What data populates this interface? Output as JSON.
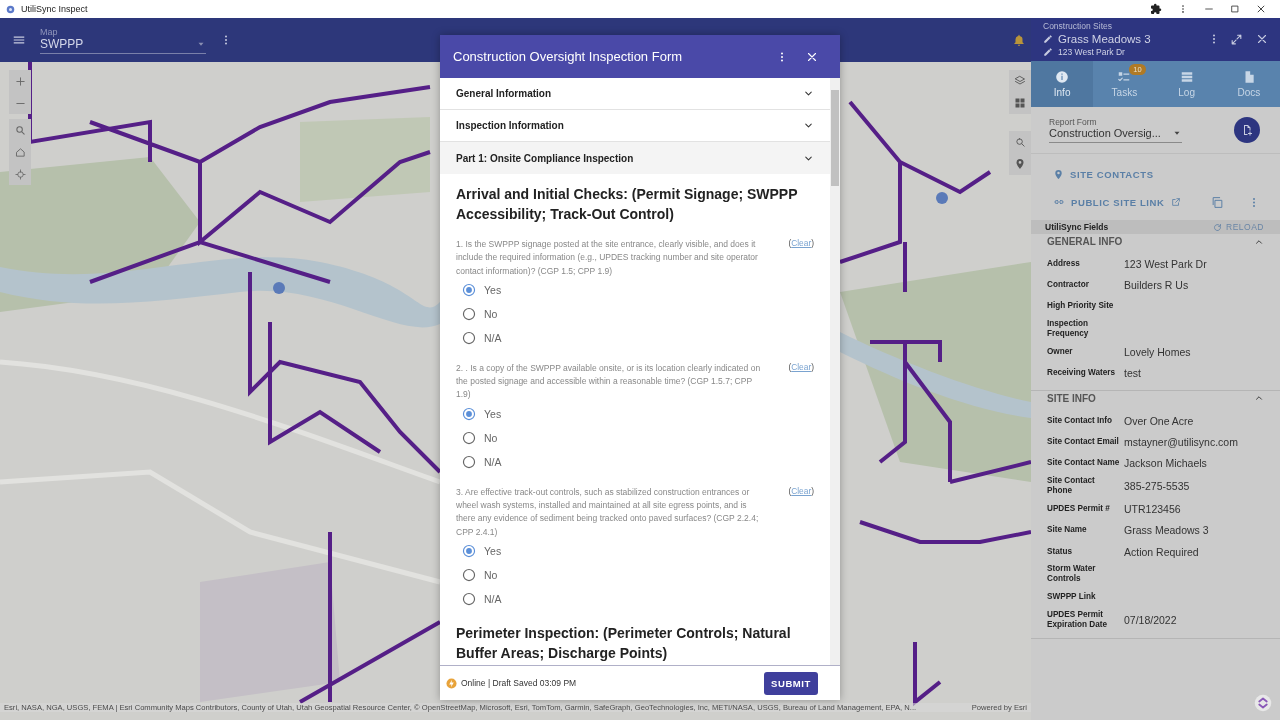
{
  "window": {
    "title": "UtiliSync Inspect"
  },
  "app_bar": {
    "label": "Map",
    "map_select": "SWPPP"
  },
  "map": {
    "kind": "picture",
    "attribution": "Esri, NASA, NGA, USGS, FEMA | Esri Community Maps Contributors, County of Utah, Utah Geospatial Resource Center, © OpenStreetMap, Microsoft, Esri, TomTom, Garmin, SafeGraph, GeoTechnologies, Inc, METI/NASA, USGS, Bureau of Land Management, EPA, N...",
    "powered_by": "Powered by Esri"
  },
  "site_panel": {
    "breadcrumb": "Construction Sites",
    "name": "Grass Meadows 3",
    "address": "123 West Park Dr",
    "tabs": [
      {
        "label": "Info",
        "selected": true
      },
      {
        "label": "Tasks",
        "selected": false,
        "badge": "10"
      },
      {
        "label": "Log",
        "selected": false
      },
      {
        "label": "Docs",
        "selected": false
      }
    ],
    "report_form": {
      "label": "Report Form",
      "value": "Construction Oversig..."
    },
    "site_contacts": "SITE CONTACTS",
    "public_site_link": "PUBLIC SITE LINK",
    "fields_header": "UtiliSync Fields",
    "reload": "RELOAD",
    "sections": [
      {
        "title": "GENERAL INFO",
        "expanded": true,
        "fields": [
          {
            "label": "Address",
            "value": "123 West Park Dr"
          },
          {
            "label": "Contractor",
            "value": "Builders R Us"
          },
          {
            "label": "High Priority Site"
          },
          {
            "label": "Inspection Frequency"
          },
          {
            "label": "Owner",
            "value": "Lovely Homes"
          },
          {
            "label": "Receiving Waters",
            "value": "test"
          }
        ]
      },
      {
        "title": "SITE INFO",
        "expanded": true,
        "fields": [
          {
            "label": "Site Contact Info",
            "value": "Over One Acre"
          },
          {
            "label": "Site Contact Email",
            "value": "mstayner@utilisync.com"
          },
          {
            "label": "Site Contact Name",
            "value": "Jackson Michaels"
          },
          {
            "label": "Site Contact Phone",
            "value": "385-275-5535"
          },
          {
            "label": "UPDES Permit #",
            "value": "UTR123456"
          },
          {
            "label": "Site Name",
            "value": "Grass Meadows 3"
          },
          {
            "label": "Status",
            "value": "Action Required"
          },
          {
            "label": "Storm Water Controls"
          },
          {
            "label": "SWPPP Link"
          },
          {
            "label": "UPDES Permit Expiration Date",
            "value": "07/18/2022"
          }
        ]
      }
    ]
  },
  "form": {
    "title": "Construction Oversight Inspection Form",
    "sections": [
      {
        "title": "General Information",
        "highlighted": false
      },
      {
        "title": "Inspection Information",
        "highlighted": false
      },
      {
        "title": "Part 1: Onsite Compliance Inspection",
        "highlighted": true
      }
    ],
    "groups": [
      {
        "heading": "Arrival and Initial Checks: (Permit Signage; SWPPP Accessibility; Track-Out Control)",
        "questions": [
          {
            "text": "1. Is the SWPPP signage posted at the site entrance, clearly visible, and does it include the required information (e.g., UPDES tracking number and site operator contact information)? (CGP 1.5; CPP 1.9)",
            "clear": {
              "open": "(",
              "label": "Clear",
              "close": ")"
            },
            "options": [
              {
                "label": "Yes",
                "selected": true
              },
              {
                "label": "No",
                "selected": false
              },
              {
                "label": "N/A",
                "selected": false
              }
            ]
          },
          {
            "text": "2. . Is a copy of the SWPPP available onsite, or is its location clearly indicated on the posted signage and accessible within a reasonable time? (CGP 1.5.7; CPP 1.9)",
            "clear": {
              "open": "(",
              "label": "Clear",
              "close": ")"
            },
            "options": [
              {
                "label": "Yes",
                "selected": true
              },
              {
                "label": "No",
                "selected": false
              },
              {
                "label": "N/A",
                "selected": false
              }
            ]
          },
          {
            "text": "3. Are effective track-out controls, such as stabilized construction entrances or wheel wash systems, installed and maintained at all site egress points, and is there any evidence of sediment being tracked onto paved surfaces? (CGP 2.2.4; CPP 2.4.1)",
            "clear": {
              "open": "(",
              "label": "Clear",
              "close": ")"
            },
            "options": [
              {
                "label": "Yes",
                "selected": true
              },
              {
                "label": "No",
                "selected": false
              },
              {
                "label": "N/A",
                "selected": false
              }
            ]
          }
        ]
      },
      {
        "heading": "Perimeter Inspection: (Perimeter Controls; Natural Buffer Areas; Discharge Points)"
      }
    ],
    "status": "Online | Draft Saved 03:09 PM",
    "submit": "SUBMIT"
  }
}
